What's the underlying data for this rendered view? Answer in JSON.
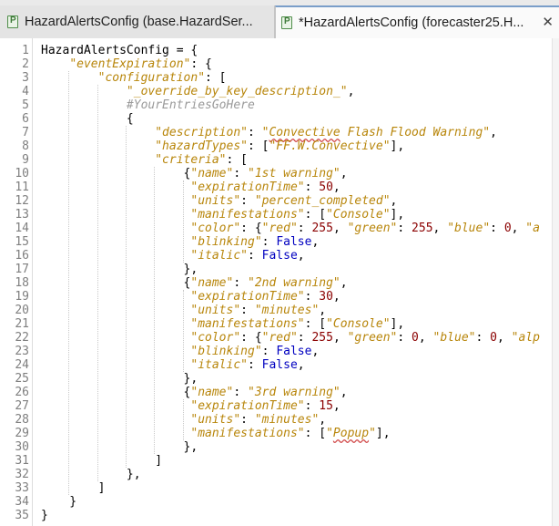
{
  "tabs": [
    {
      "label": "HazardAlertsConfig (base.HazardSer...",
      "active": false
    },
    {
      "label": "*HazardAlertsConfig (forecaster25.H...",
      "active": true,
      "close": "✕"
    }
  ],
  "colors": {
    "key": "#b8860b",
    "string": "#b8860b",
    "number": "#8b0000",
    "builtin": "#0000c0",
    "comment": "#9a9a9a",
    "line_number": "#7f7f7f",
    "active_tab_border": "#7a9ec9"
  },
  "editor": {
    "lines": [
      [
        {
          "t": "HazardAlertsConfig = {"
        }
      ],
      [
        {
          "t": "    "
        },
        {
          "t": "\"eventExpiration\"",
          "c": "k"
        },
        {
          "t": ": {"
        }
      ],
      [
        {
          "t": "        "
        },
        {
          "t": "\"configuration\"",
          "c": "k"
        },
        {
          "t": ": ["
        }
      ],
      [
        {
          "t": "            "
        },
        {
          "t": "\"_override_by_key_description_\"",
          "c": "s"
        },
        {
          "t": ","
        }
      ],
      [
        {
          "t": "            "
        },
        {
          "t": "#YourEntriesGoHere",
          "c": "c"
        }
      ],
      [
        {
          "t": "            {"
        }
      ],
      [
        {
          "t": "                "
        },
        {
          "t": "\"description\"",
          "c": "k"
        },
        {
          "t": ": "
        },
        {
          "t": "\"",
          "c": "s"
        },
        {
          "t": "Convective",
          "c": "s sq"
        },
        {
          "t": " Flash Flood Warning\"",
          "c": "s"
        },
        {
          "t": ","
        }
      ],
      [
        {
          "t": "                "
        },
        {
          "t": "\"hazardTypes\"",
          "c": "k"
        },
        {
          "t": ": ["
        },
        {
          "t": "\"FF.W.Convective\"",
          "c": "s"
        },
        {
          "t": "],"
        }
      ],
      [
        {
          "t": "                "
        },
        {
          "t": "\"criteria\"",
          "c": "k"
        },
        {
          "t": ": ["
        }
      ],
      [
        {
          "t": "                    {"
        },
        {
          "t": "\"name\"",
          "c": "k"
        },
        {
          "t": ": "
        },
        {
          "t": "\"1st warning\"",
          "c": "s"
        },
        {
          "t": ","
        }
      ],
      [
        {
          "t": "                     "
        },
        {
          "t": "\"expirationTime\"",
          "c": "k"
        },
        {
          "t": ": "
        },
        {
          "t": "50",
          "c": "n"
        },
        {
          "t": ","
        }
      ],
      [
        {
          "t": "                     "
        },
        {
          "t": "\"units\"",
          "c": "k"
        },
        {
          "t": ": "
        },
        {
          "t": "\"percent_completed\"",
          "c": "s"
        },
        {
          "t": ","
        }
      ],
      [
        {
          "t": "                     "
        },
        {
          "t": "\"manifestations\"",
          "c": "k"
        },
        {
          "t": ": ["
        },
        {
          "t": "\"Console\"",
          "c": "s"
        },
        {
          "t": "],"
        }
      ],
      [
        {
          "t": "                     "
        },
        {
          "t": "\"color\"",
          "c": "k"
        },
        {
          "t": ": {"
        },
        {
          "t": "\"red\"",
          "c": "k"
        },
        {
          "t": ": "
        },
        {
          "t": "255",
          "c": "n"
        },
        {
          "t": ", "
        },
        {
          "t": "\"green\"",
          "c": "k"
        },
        {
          "t": ": "
        },
        {
          "t": "255",
          "c": "n"
        },
        {
          "t": ", "
        },
        {
          "t": "\"blue\"",
          "c": "k"
        },
        {
          "t": ": "
        },
        {
          "t": "0",
          "c": "n"
        },
        {
          "t": ", "
        },
        {
          "t": "\"a",
          "c": "k"
        }
      ],
      [
        {
          "t": "                     "
        },
        {
          "t": "\"blinking\"",
          "c": "k"
        },
        {
          "t": ": "
        },
        {
          "t": "False",
          "c": "b"
        },
        {
          "t": ","
        }
      ],
      [
        {
          "t": "                     "
        },
        {
          "t": "\"italic\"",
          "c": "k"
        },
        {
          "t": ": "
        },
        {
          "t": "False",
          "c": "b"
        },
        {
          "t": ","
        }
      ],
      [
        {
          "t": "                    },"
        }
      ],
      [
        {
          "t": "                    {"
        },
        {
          "t": "\"name\"",
          "c": "k"
        },
        {
          "t": ": "
        },
        {
          "t": "\"2nd warning\"",
          "c": "s"
        },
        {
          "t": ","
        }
      ],
      [
        {
          "t": "                     "
        },
        {
          "t": "\"expirationTime\"",
          "c": "k"
        },
        {
          "t": ": "
        },
        {
          "t": "30",
          "c": "n"
        },
        {
          "t": ","
        }
      ],
      [
        {
          "t": "                     "
        },
        {
          "t": "\"units\"",
          "c": "k"
        },
        {
          "t": ": "
        },
        {
          "t": "\"minutes\"",
          "c": "s"
        },
        {
          "t": ","
        }
      ],
      [
        {
          "t": "                     "
        },
        {
          "t": "\"manifestations\"",
          "c": "k"
        },
        {
          "t": ": ["
        },
        {
          "t": "\"Console\"",
          "c": "s"
        },
        {
          "t": "],"
        }
      ],
      [
        {
          "t": "                     "
        },
        {
          "t": "\"color\"",
          "c": "k"
        },
        {
          "t": ": {"
        },
        {
          "t": "\"red\"",
          "c": "k"
        },
        {
          "t": ": "
        },
        {
          "t": "255",
          "c": "n"
        },
        {
          "t": ", "
        },
        {
          "t": "\"green\"",
          "c": "k"
        },
        {
          "t": ": "
        },
        {
          "t": "0",
          "c": "n"
        },
        {
          "t": ", "
        },
        {
          "t": "\"blue\"",
          "c": "k"
        },
        {
          "t": ": "
        },
        {
          "t": "0",
          "c": "n"
        },
        {
          "t": ", "
        },
        {
          "t": "\"alp",
          "c": "k"
        }
      ],
      [
        {
          "t": "                     "
        },
        {
          "t": "\"blinking\"",
          "c": "k"
        },
        {
          "t": ": "
        },
        {
          "t": "False",
          "c": "b"
        },
        {
          "t": ","
        }
      ],
      [
        {
          "t": "                     "
        },
        {
          "t": "\"italic\"",
          "c": "k"
        },
        {
          "t": ": "
        },
        {
          "t": "False",
          "c": "b"
        },
        {
          "t": ","
        }
      ],
      [
        {
          "t": "                    },"
        }
      ],
      [
        {
          "t": "                    {"
        },
        {
          "t": "\"name\"",
          "c": "k"
        },
        {
          "t": ": "
        },
        {
          "t": "\"3rd warning\"",
          "c": "s"
        },
        {
          "t": ","
        }
      ],
      [
        {
          "t": "                     "
        },
        {
          "t": "\"expirationTime\"",
          "c": "k"
        },
        {
          "t": ": "
        },
        {
          "t": "15",
          "c": "n"
        },
        {
          "t": ","
        }
      ],
      [
        {
          "t": "                     "
        },
        {
          "t": "\"units\"",
          "c": "k"
        },
        {
          "t": ": "
        },
        {
          "t": "\"minutes\"",
          "c": "s"
        },
        {
          "t": ","
        }
      ],
      [
        {
          "t": "                     "
        },
        {
          "t": "\"manifestations\"",
          "c": "k"
        },
        {
          "t": ": ["
        },
        {
          "t": "\"",
          "c": "s"
        },
        {
          "t": "Popup",
          "c": "s sq"
        },
        {
          "t": "\"",
          "c": "s"
        },
        {
          "t": "],"
        }
      ],
      [
        {
          "t": "                    },"
        }
      ],
      [
        {
          "t": "                ]"
        }
      ],
      [
        {
          "t": "            },"
        }
      ],
      [
        {
          "t": "        ]"
        }
      ],
      [
        {
          "t": "    }"
        }
      ],
      [
        {
          "t": "}"
        }
      ]
    ]
  }
}
